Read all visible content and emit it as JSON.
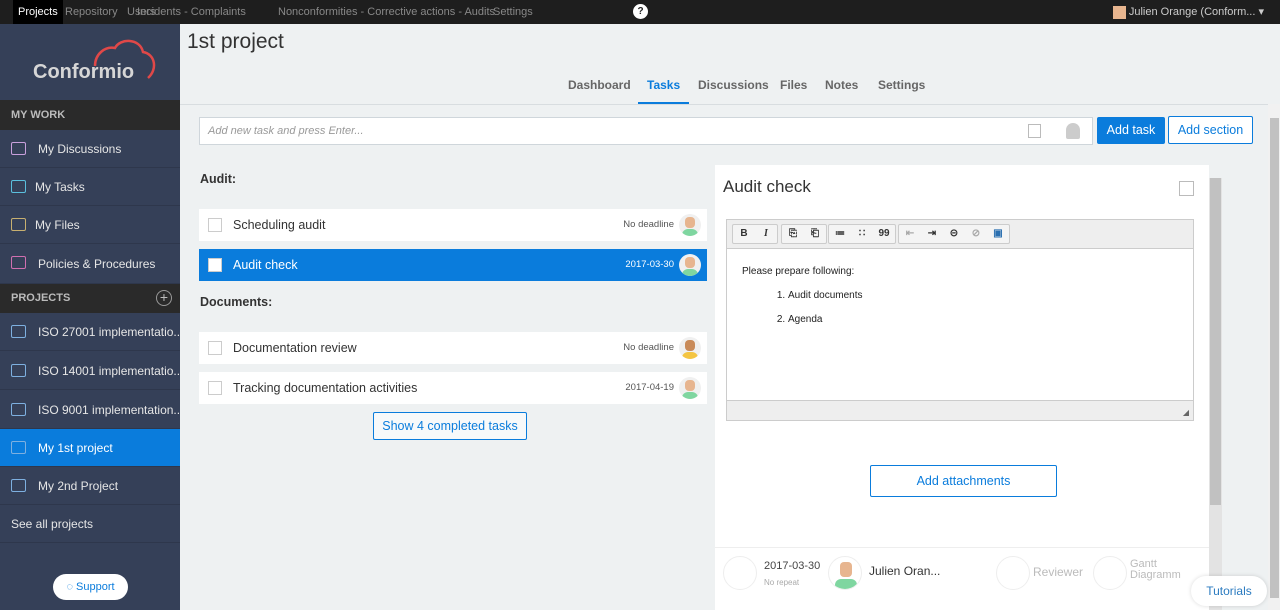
{
  "topnav": {
    "items": [
      "Projects",
      "Repository",
      "Users",
      "Incidents - Complaints",
      "Nonconformities - Corrective actions - Audits",
      "Settings"
    ],
    "help": "?",
    "user": "Julien Orange (Conform... ▾"
  },
  "brand": {
    "logo": "Conformio",
    "accent": "#0a7cdc",
    "logo_red": "#e04848"
  },
  "sidebar": {
    "my_work": "MY WORK",
    "work_items": [
      "My Discussions",
      "My Tasks",
      "My Files",
      "Policies & Procedures"
    ],
    "projects_head": "PROJECTS",
    "projects": [
      "ISO 27001 implementatio...",
      "ISO 14001 implementatio...",
      "ISO 9001 implementation...",
      "My 1st project",
      "My 2nd Project"
    ],
    "see_all": "See all projects",
    "support": "Support"
  },
  "page": {
    "title": "1st project",
    "tabs": [
      "Dashboard",
      "Tasks",
      "Discussions",
      "Files",
      "Notes",
      "Settings"
    ],
    "active_tab": "Tasks"
  },
  "newtask": {
    "placeholder": "Add new task and press Enter...",
    "add_task": "Add task",
    "add_section": "Add section"
  },
  "sections": [
    {
      "title": "Audit:",
      "tasks": [
        {
          "name": "Scheduling audit",
          "deadline": "No deadline"
        },
        {
          "name": "Audit check",
          "deadline": "2017-03-30",
          "selected": true
        }
      ]
    },
    {
      "title": "Documents:",
      "tasks": [
        {
          "name": "Documentation review",
          "deadline": "No deadline"
        },
        {
          "name": "Tracking documentation activities",
          "deadline": "2017-04-19"
        }
      ]
    }
  ],
  "show_completed": "Show 4 completed tasks",
  "detail": {
    "title": "Audit check",
    "toolbar": [
      "B",
      "I",
      "⎘",
      "⎗",
      "≔",
      "∷",
      "99",
      "⇤",
      "⇥",
      "⊝",
      "⊘",
      "▣"
    ],
    "body_intro": "Please prepare following:",
    "body_list": [
      "Audit documents",
      "Agenda"
    ],
    "add_attachments": "Add attachments",
    "date": "2017-03-30",
    "repeat": "No repeat",
    "assignee": "Julien Oran...",
    "reviewer": "Reviewer",
    "gantt1": "Gantt",
    "gantt2": "Diagramm"
  },
  "tutorials": "Tutorials"
}
